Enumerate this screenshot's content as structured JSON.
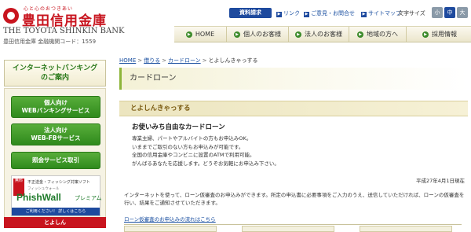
{
  "header": {
    "catchphrase": "心と心のおつきあい",
    "bank_name_jp": "豊田信用金庫",
    "bank_name_en": "THE TOYOTA SHINKIN BANK",
    "bank_code": "豊田信用金庫 金融機関コード：1559",
    "utility": {
      "request_label": "資料請求",
      "links": [
        "リンク",
        "ご意見・お問合せ",
        "サイトマップ"
      ],
      "font_size_label": "文字サイズ",
      "font_sizes": [
        "小",
        "中",
        "大"
      ],
      "active_font_size": "中"
    }
  },
  "gnav": {
    "items": [
      "HOME",
      "個人のお客様",
      "法人のお客様",
      "地域の方へ",
      "採用情報"
    ]
  },
  "sidebar": {
    "heading_line1": "インターネットバンキング",
    "heading_line2": "のご案内",
    "buttons": [
      {
        "line1": "個人向け",
        "line2": "WEBバンキングサービス"
      },
      {
        "line1": "法人向け",
        "line2": "WEB-FBサービス"
      },
      {
        "line1": "照会サービス取引",
        "line2": ""
      }
    ],
    "banner": {
      "tag": "無料",
      "small_text": "不正送金・フィッシング対策ソフト",
      "small_text2": "フィッシュウォール",
      "brand": "PhishWall",
      "brand_suffix": "プレミアム",
      "cta": "ご利用ください！ 詳しくはこちら"
    },
    "bottom_label": "とよしん"
  },
  "main": {
    "breadcrumb": [
      "HOME",
      "借りる",
      "カードローン",
      "とよしんきゃっする"
    ],
    "title": "カードローン",
    "section_heading": "とよしんきゃっする",
    "lead": "お使いみち自由なカードローン",
    "description": [
      "専業主婦、パートやアルバイトの方もお申込みOK。",
      "いままでご取引のない方もお申込みが可能です。",
      "全国の信用金庫やコンビニに設置のATMで利用可能。",
      "がんばるあなたを応援します。どうぞお気軽にお申込み下さい。"
    ],
    "as_of": "平成27年4月1日現在",
    "note": "インターネットを使って、ローン仮審査のお申込みができます。所定の申込書に必要事項をご入力のうえ、送信していただければ、ローンの仮審査を行い、結果をご通知させていただきます。",
    "flow_link": "ローン仮審査のお申込みの流れはこちら"
  },
  "colors": {
    "brand_red": "#c8141e",
    "nav_green": "#2f8a1c",
    "link_blue": "#1a4fa0",
    "utility_blue": "#1e4a9e"
  },
  "icons": [
    "logo-mark-icon",
    "arrow-right-icon",
    "nav-dot-icon"
  ]
}
